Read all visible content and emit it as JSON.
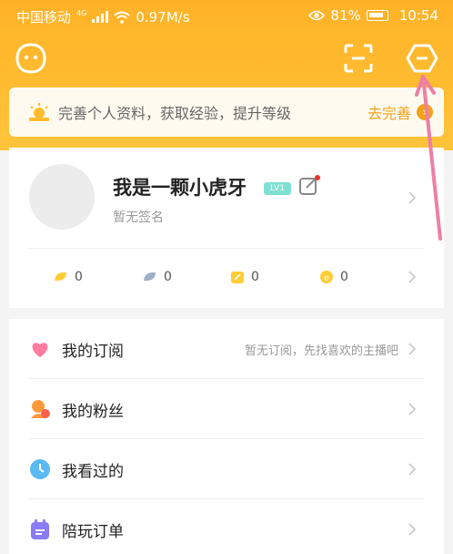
{
  "status": {
    "carrier": "中国移动",
    "net_badge": "4G",
    "speed": "0.97M/s",
    "battery": "81%",
    "time": "10:54"
  },
  "banner": {
    "text": "完善个人资料，获取经验，提升等级",
    "action": "去完善"
  },
  "profile": {
    "name": "我是一颗小虎牙",
    "level": "LV1",
    "signature": "暂无签名"
  },
  "stats": [
    {
      "icon": "gold-coin-icon",
      "value": "0"
    },
    {
      "icon": "diamond-icon",
      "value": "0"
    },
    {
      "icon": "ticket-icon",
      "value": "0"
    },
    {
      "icon": "e-coin-icon",
      "value": "0"
    }
  ],
  "menu": [
    {
      "label": "我的订阅",
      "hint": "暂无订阅，先找喜欢的主播吧"
    },
    {
      "label": "我的粉丝",
      "hint": ""
    },
    {
      "label": "我看过的",
      "hint": ""
    },
    {
      "label": "陪玩订单",
      "hint": ""
    }
  ],
  "colors": {
    "header": "#ffb226",
    "accent": "#f3a21a",
    "level_badge": "#7fe0d3",
    "arrow": "#ee7fa3"
  }
}
